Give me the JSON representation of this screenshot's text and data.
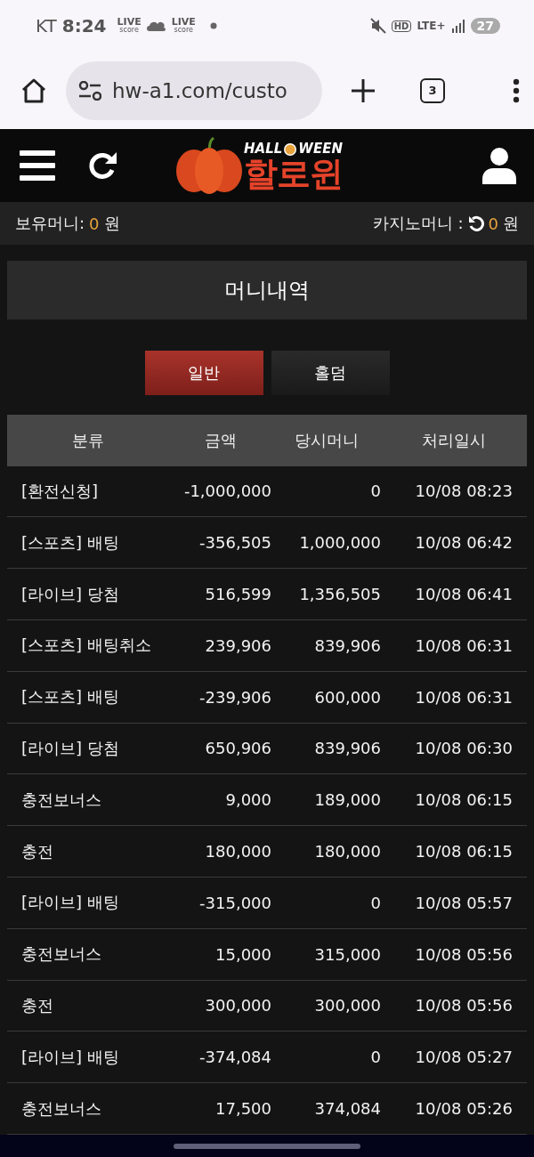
{
  "status_bar": {
    "carrier": "KT",
    "time": "8:24",
    "live_badges": [
      {
        "top": "LIVE",
        "bottom": "score"
      },
      {
        "top": "LIVE",
        "bottom": "score"
      }
    ],
    "hd": "HD",
    "network": "LTE+",
    "battery": "27"
  },
  "browser": {
    "url": "hw-a1.com/custo",
    "tab_count": "3"
  },
  "header": {
    "logo": {
      "top_left": "HALL",
      "top_right": "WEEN",
      "main": "할로윈"
    }
  },
  "money_bar": {
    "held_label": "보유머니:",
    "held_value": "0",
    "held_unit": "원",
    "casino_label": "카지노머니 :",
    "casino_value": "0",
    "casino_unit": "원"
  },
  "page_title": "머니내역",
  "tabs": [
    {
      "label": "일반",
      "selected": true
    },
    {
      "label": "홀덤",
      "selected": false
    }
  ],
  "table": {
    "columns": [
      "분류",
      "금액",
      "당시머니",
      "처리일시"
    ],
    "rows": [
      [
        "[환전신청]",
        "-1,000,000",
        "0",
        "10/08 08:23"
      ],
      [
        "[스포츠] 배팅",
        "-356,505",
        "1,000,000",
        "10/08 06:42"
      ],
      [
        "[라이브] 당첨",
        "516,599",
        "1,356,505",
        "10/08 06:41"
      ],
      [
        "[스포츠] 배팅취소",
        "239,906",
        "839,906",
        "10/08 06:31"
      ],
      [
        "[스포츠] 배팅",
        "-239,906",
        "600,000",
        "10/08 06:31"
      ],
      [
        "[라이브] 당첨",
        "650,906",
        "839,906",
        "10/08 06:30"
      ],
      [
        "충전보너스",
        "9,000",
        "189,000",
        "10/08 06:15"
      ],
      [
        "충전",
        "180,000",
        "180,000",
        "10/08 06:15"
      ],
      [
        "[라이브] 배팅",
        "-315,000",
        "0",
        "10/08 05:57"
      ],
      [
        "충전보너스",
        "15,000",
        "315,000",
        "10/08 05:56"
      ],
      [
        "충전",
        "300,000",
        "300,000",
        "10/08 05:56"
      ],
      [
        "[라이브] 배팅",
        "-374,084",
        "0",
        "10/08 05:27"
      ],
      [
        "충전보너스",
        "17,500",
        "374,084",
        "10/08 05:26"
      ]
    ]
  }
}
